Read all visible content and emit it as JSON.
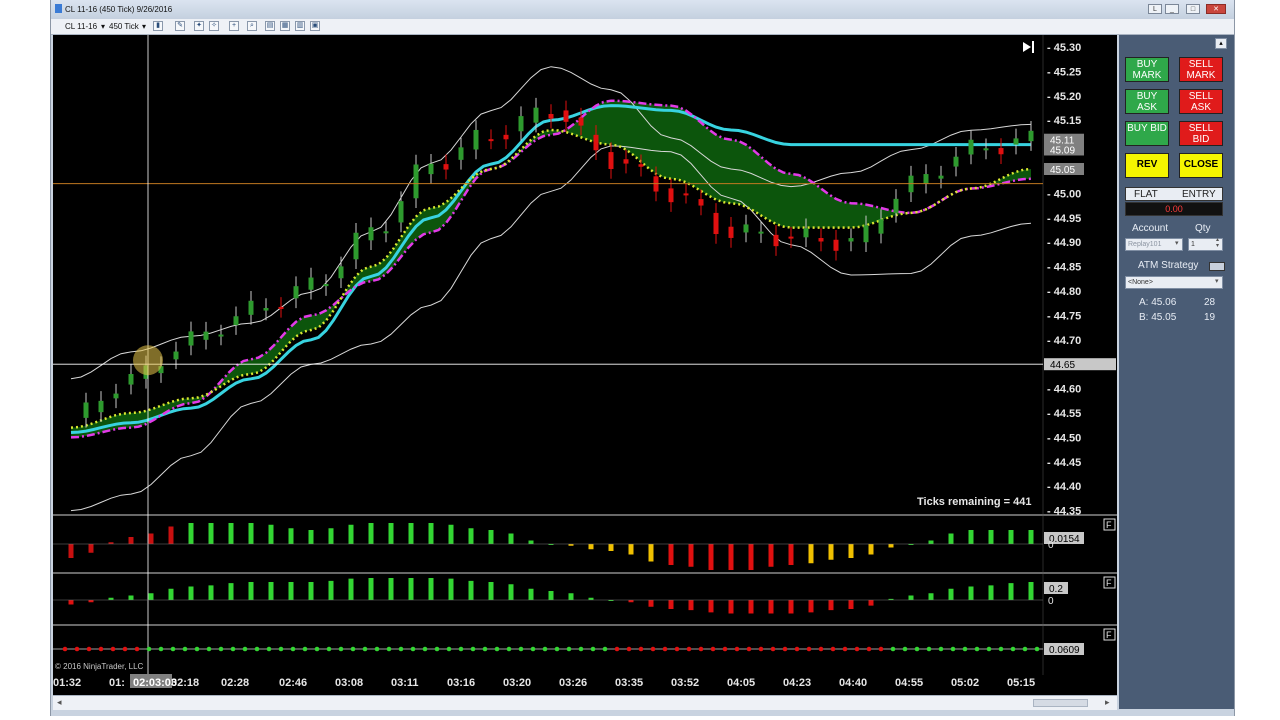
{
  "window": {
    "title": "CL 11-16 (450 Tick)  9/26/2016",
    "controls": [
      "L",
      "_",
      "□",
      "✕"
    ]
  },
  "toolbar": {
    "instrument": "CL 11-16",
    "interval": "450 Tick"
  },
  "chart": {
    "price_labels": [
      "45.30",
      "45.25",
      "45.20",
      "45.15",
      "45.10",
      "45.05",
      "45.00",
      "44.95",
      "44.90",
      "44.85",
      "44.80",
      "44.75",
      "44.70",
      "44.65",
      "44.60",
      "44.55",
      "44.50",
      "44.45",
      "44.40",
      "44.35"
    ],
    "price_tags": [
      "45.11",
      "45.09",
      "45.05",
      "44.65"
    ],
    "time_labels": [
      "01:32",
      "01:",
      "02:18",
      "02:28",
      "02:46",
      "03:08",
      "03:11",
      "03:16",
      "03:20",
      "03:26",
      "03:35",
      "03:52",
      "04:05",
      "04:23",
      "04:40",
      "04:55",
      "05:02",
      "05:15"
    ],
    "crosshair_time": "02:03:03",
    "ticks_remaining": "Ticks remaining = 441",
    "copyright": "© 2016 NinjaTrader, LLC",
    "indicator_values": [
      "0.0154",
      "0.2",
      "0.0609"
    ],
    "indicator_zero_labels": [
      "0",
      "0"
    ],
    "panel_flag": "F",
    "colors": {
      "up_candle": "#2e9a2e",
      "down_candle": "#e01010",
      "cloud": "#0d5e0d",
      "cyan_ma": "#38d3e0",
      "magenta_ma": "#e23ae8",
      "yellow_ma": "#d9e830",
      "band": "#d8d8d8"
    }
  },
  "chart_data": {
    "type": "line",
    "title": "",
    "xlabel": "",
    "ylabel": "",
    "x": [
      "01:32",
      "02:18",
      "02:28",
      "02:46",
      "03:08",
      "03:11",
      "03:16",
      "03:20",
      "03:26",
      "03:35",
      "03:52",
      "04:05",
      "04:23",
      "04:40",
      "04:55",
      "05:02",
      "05:15"
    ],
    "ylim": [
      44.35,
      45.3
    ],
    "crosshair_price": 44.65,
    "series": [
      {
        "values": [
          44.54,
          44.62,
          44.7,
          44.76,
          44.81,
          44.92,
          45.06,
          45.12,
          45.17,
          45.07,
          45.0,
          44.92,
          44.91,
          44.9,
          45.02,
          45.09,
          45.11
        ]
      },
      {
        "values": [
          44.52,
          44.55,
          44.58,
          44.63,
          44.72,
          44.85,
          44.97,
          45.05,
          45.13,
          45.1,
          45.03,
          44.98,
          44.93,
          44.93,
          44.96,
          45.01,
          45.05
        ]
      },
      {
        "values": [
          44.51,
          44.53,
          44.56,
          44.62,
          44.7,
          44.83,
          44.95,
          45.06,
          45.15,
          45.18,
          45.17,
          45.13,
          45.1,
          45.1,
          45.1,
          45.1,
          45.1
        ]
      },
      {
        "values": [
          44.5,
          44.52,
          44.57,
          44.66,
          44.75,
          44.82,
          44.92,
          45.05,
          45.12,
          45.19,
          45.18,
          45.11,
          45.04,
          44.98,
          44.96,
          45.01,
          45.03
        ]
      }
    ],
    "indicators": [
      {
        "last_value": 0.0154,
        "values": [
          -0.02,
          0.01,
          0.03,
          0.03,
          0.02,
          0.03,
          0.03,
          0.02,
          0.0,
          -0.01,
          -0.03,
          -0.04,
          -0.03,
          -0.02,
          0.0,
          0.02,
          0.02
        ]
      },
      {
        "last_value": 0.2,
        "values": [
          -0.05,
          0.05,
          0.15,
          0.2,
          0.2,
          0.25,
          0.25,
          0.2,
          0.1,
          0.0,
          -0.1,
          -0.15,
          -0.15,
          -0.1,
          0.05,
          0.15,
          0.2
        ]
      },
      {
        "last_value": 0.0609
      }
    ]
  },
  "panel": {
    "buy_mark": "BUY MARK",
    "sell_mark": "SELL MARK",
    "buy_ask": "BUY ASK",
    "sell_ask": "SELL ASK",
    "buy_bid": "BUY BID",
    "sell_bid": "SELL BID",
    "rev": "REV",
    "close": "CLOSE",
    "flat": "FLAT",
    "entry": "ENTRY",
    "pnl": "0.00",
    "account_label": "Account",
    "qty_label": "Qty",
    "account_value": "Replay101",
    "qty_value": "1",
    "atm_label": "ATM Strategy",
    "atm_value": "<None>",
    "ask_label": "A: 45.06",
    "ask_size": "28",
    "bid_label": "B: 45.05",
    "bid_size": "19"
  }
}
